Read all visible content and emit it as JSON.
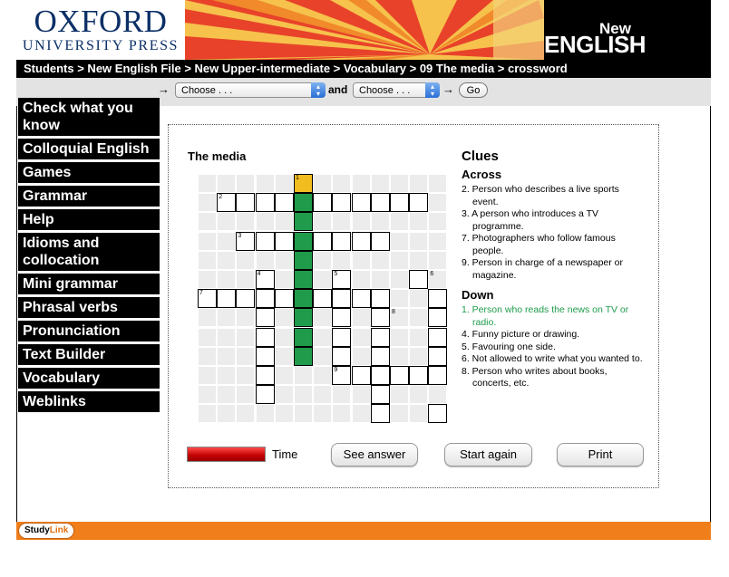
{
  "header": {
    "logo_line1": "OXFORD",
    "logo_line2": "UNIVERSITY PRESS",
    "brand_line1": "New",
    "brand_line2": "ENGLISH FILE"
  },
  "breadcrumb": "Students > New English File > New Upper-intermediate > Vocabulary > 09 The media > crossword",
  "chooser": {
    "select1": "Choose . . .",
    "and_label": "and",
    "select2": "Choose . . .",
    "go_label": "Go"
  },
  "sidebar": {
    "items": [
      {
        "label": "Check what you know"
      },
      {
        "label": "Colloquial English"
      },
      {
        "label": "Games"
      },
      {
        "label": "Grammar"
      },
      {
        "label": "Help"
      },
      {
        "label": "Idioms and collocation"
      },
      {
        "label": "Mini grammar"
      },
      {
        "label": "Phrasal verbs"
      },
      {
        "label": "Pronunciation"
      },
      {
        "label": "Text Builder"
      },
      {
        "label": "Vocabulary"
      },
      {
        "label": "Weblinks"
      }
    ]
  },
  "puzzle": {
    "title": "The media",
    "numbers": [
      "1",
      "2",
      "3",
      "4",
      "5",
      "6",
      "7",
      "8",
      "9"
    ]
  },
  "clues": {
    "title": "Clues",
    "across_label": "Across",
    "across": [
      "2. Person who describes a live sports event.",
      "3. A person who introduces a TV programme.",
      "7. Photographers who follow famous people.",
      "9. Person in charge of a newspaper or magazine."
    ],
    "down_label": "Down",
    "down": [
      "1. Person who reads the news on TV or radio.",
      "4. Funny picture or drawing.",
      "5. Favouring one side.",
      "6. Not allowed to write what you wanted to.",
      "8. Person who writes about books, concerts, etc."
    ]
  },
  "controls": {
    "time_label": "Time",
    "see_answer": "See answer",
    "start_again": "Start again",
    "print": "Print",
    "time_remaining_fraction": 1.0
  },
  "footer": {
    "studylink_a": "Study",
    "studylink_b": "Link"
  },
  "colors": {
    "active_cell": "#1f9b4b",
    "selected_cell": "#f2bd1f",
    "footer": "#f07e1a"
  }
}
